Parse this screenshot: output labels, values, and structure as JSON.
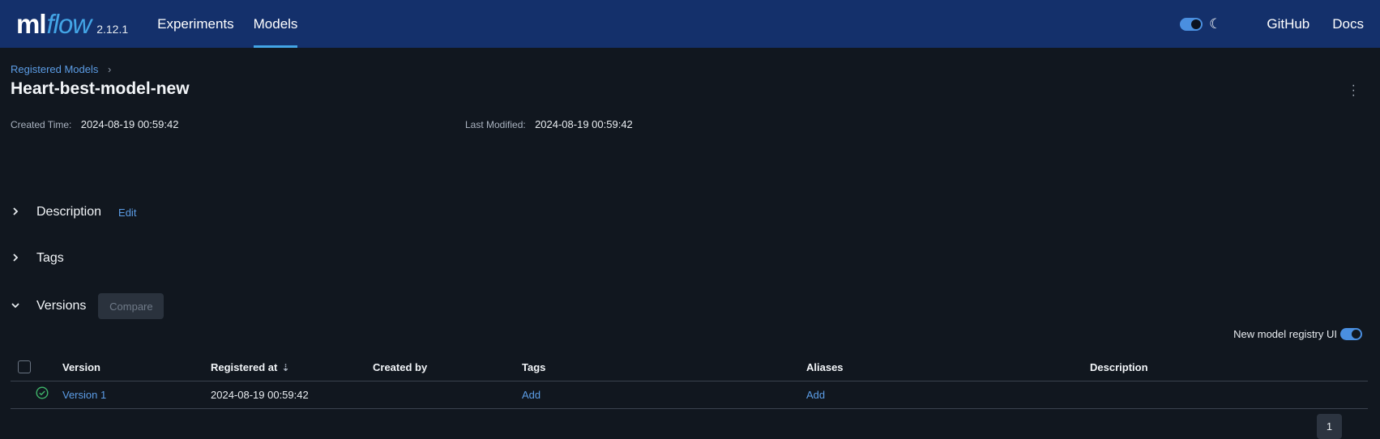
{
  "header": {
    "logo_ml": "ml",
    "logo_flow": "flow",
    "version": "2.12.1",
    "nav": [
      {
        "label": "Experiments",
        "active": false
      },
      {
        "label": "Models",
        "active": true
      }
    ],
    "github_label": "GitHub",
    "docs_label": "Docs",
    "dark_mode": true,
    "accent_color": "#43a5e6",
    "bg_color": "#14306b"
  },
  "breadcrumb": {
    "label": "Registered Models",
    "separator": "›"
  },
  "page": {
    "title": "Heart-best-model-new",
    "created_label": "Created Time:",
    "created_value": "2024-08-19 00:59:42",
    "modified_label": "Last Modified:",
    "modified_value": "2024-08-19 00:59:42"
  },
  "sections": {
    "description": {
      "label": "Description",
      "edit_label": "Edit",
      "expanded": false
    },
    "tags": {
      "label": "Tags",
      "expanded": false
    },
    "versions": {
      "label": "Versions",
      "compare_label": "Compare",
      "expanded": true
    }
  },
  "registry_toggle": {
    "label": "New model registry UI",
    "on": true
  },
  "table": {
    "columns": [
      "Version",
      "Registered at",
      "Created by",
      "Tags",
      "Aliases",
      "Description"
    ],
    "rows": [
      {
        "status": "ready",
        "version": "Version 1",
        "registered_at": "2024-08-19 00:59:42",
        "created_by": "",
        "tags_action": "Add",
        "aliases_action": "Add",
        "description": ""
      }
    ]
  },
  "pagination": {
    "current_page": "1"
  }
}
